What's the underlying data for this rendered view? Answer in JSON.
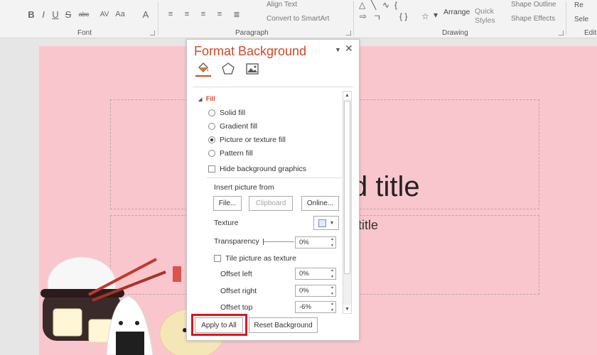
{
  "ribbon": {
    "font_group_label": "Font",
    "paragraph_group_label": "Paragraph",
    "drawing_group_label": "Drawing",
    "editing_group_label_partial": "Edit",
    "align_text": "Align Text",
    "convert_smartart": "Convert to SmartArt",
    "arrange": "Arrange",
    "quick_styles": "Quick\nStyles",
    "quick_line1": "Quick",
    "quick_line2": "Styles",
    "shape_outline": "Shape Outline",
    "shape_effects": "Shape Effects",
    "replace_partial": "Re",
    "select_partial": "Sele",
    "bold": "B",
    "italic": "I",
    "underline": "U",
    "strike": "S",
    "shadow_label": "abc",
    "spacing": "AV",
    "case": "Aa",
    "font_color": "A"
  },
  "slide": {
    "title_text": "d title",
    "subtitle_text": "title"
  },
  "pane": {
    "title": "Format Background",
    "fill_section": "Fill",
    "options": {
      "solid": "Solid fill",
      "gradient": "Gradient fill",
      "picture": "Picture or texture fill",
      "pattern": "Pattern fill"
    },
    "selected_option": "picture",
    "hide_bg": "Hide background graphics",
    "insert_from": "Insert picture from",
    "file_btn": "File...",
    "clipboard_btn": "Clipboard",
    "online_btn": "Online...",
    "texture_label": "Texture",
    "transparency_label": "Transparency",
    "transparency_value": "0%",
    "tile_label": "Tile picture as texture",
    "offset_left_label": "Offset left",
    "offset_left_value": "0%",
    "offset_right_label": "Offset right",
    "offset_right_value": "0%",
    "offset_top_label": "Offset top",
    "offset_top_value": "-6%",
    "apply_all_btn": "Apply to All",
    "reset_btn": "Reset Background"
  },
  "colors": {
    "accent": "#d24726",
    "slide_bg": "#fac6ce",
    "highlight": "#e0141e"
  },
  "icons": [
    "paint-bucket-icon",
    "pentagon-icon",
    "picture-icon",
    "pane-options-icon",
    "close-icon"
  ]
}
